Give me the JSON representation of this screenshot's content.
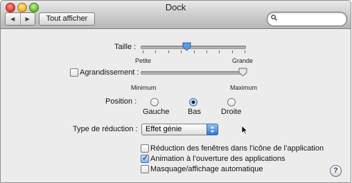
{
  "window": {
    "title": "Dock"
  },
  "toolbar": {
    "show_all_label": "Tout afficher",
    "back_icon": "back-icon",
    "forward_icon": "forward-icon"
  },
  "search": {
    "value": "",
    "placeholder": ""
  },
  "size": {
    "label": "Taille :",
    "min_label": "Petite",
    "max_label": "Grande",
    "value_fraction": 0.44
  },
  "magnification": {
    "label": "Agrandissement :",
    "checked": false,
    "min_label": "Minimum",
    "max_label": "Maximum",
    "value_fraction": 1.0
  },
  "position": {
    "label": "Position :",
    "options": [
      "Gauche",
      "Bas",
      "Droite"
    ],
    "selected": "Bas"
  },
  "minimize_effect": {
    "label": "Type de réduction :",
    "value": "Effet génie"
  },
  "options": [
    {
      "label": "Réduction des fenêtres dans l’icône de l’application",
      "checked": false
    },
    {
      "label": "Animation à l’ouverture des applications",
      "checked": true
    },
    {
      "label": "Masquage/affichage automatique",
      "checked": false
    }
  ],
  "help_label": "?",
  "accent": "#3a7bd5"
}
